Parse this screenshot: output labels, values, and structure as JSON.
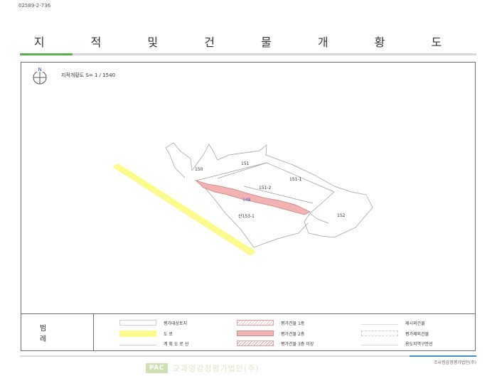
{
  "document": {
    "id_text": "02589-2-736",
    "title": "지 적 및 건 물 개 황 도"
  },
  "map": {
    "scale_label": "지적개황도 S= 1 / 1540",
    "north_label": "N",
    "parcels": {
      "p150": "150",
      "p151": "151",
      "p151_1": "151-1",
      "p151_2": "151-2",
      "p149": "149",
      "p152": "152",
      "p153_1": "산153-1"
    }
  },
  "legend": {
    "title": "범 례",
    "items": [
      {
        "label": "평가대상토지",
        "swatch": "border"
      },
      {
        "label": "도 로",
        "swatch": "road"
      },
      {
        "label": "계 획 도 로 선",
        "swatch": "line"
      },
      {
        "label": "평가건물 1층",
        "swatch": "hatch1"
      },
      {
        "label": "평가건물 2층",
        "swatch": "hatch2"
      },
      {
        "label": "평가건물 3층 이상",
        "swatch": "hatch3"
      },
      {
        "label": "제시외건물",
        "swatch": "plain"
      },
      {
        "label": "평가제외건물",
        "swatch": "dash"
      },
      {
        "label": "용도지역구분선",
        "swatch": "plain"
      }
    ]
  },
  "footer": {
    "company_right": "조사컴감정평가법인(주)",
    "logo_badge": "PAC",
    "logo_text": "교과영감정평가법인(주)"
  },
  "colors": {
    "accent_green": "#58b24a",
    "accent_blue": "#3f8fd0",
    "road_yellow": "#fbfa8a",
    "subject_parcel": "#f3b3b3"
  }
}
